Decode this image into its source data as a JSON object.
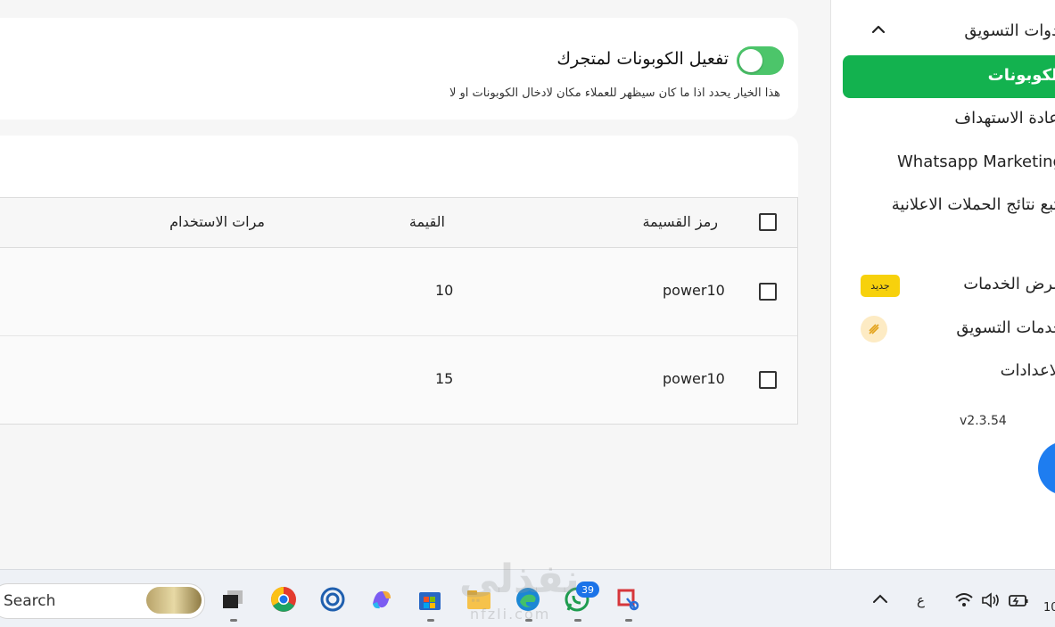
{
  "sidebar": {
    "parent_label": "أدوات التسويق",
    "active_label": "الكوبونات",
    "items": [
      {
        "label": "اعادة الاستهداف"
      },
      {
        "label": "Whatsapp Marketing"
      },
      {
        "label": "تتبع نتائج الحملات الاعلانية"
      },
      {
        "label": "عرض الخدمات"
      },
      {
        "label": "خدمات التسويق"
      },
      {
        "label": "الاعدادات"
      }
    ],
    "new_badge": "جديد",
    "version": "v2.3.54"
  },
  "coupon_settings": {
    "toggle_label": "تفعيل الكوبونات لمتجرك",
    "toggle_on": true,
    "description": "هذا الخيار يحدد اذا ما كان سيظهر للعملاء مكان لادخال الكوبونات او لا"
  },
  "table": {
    "headers": {
      "code": "رمز القسيمة",
      "value": "القيمة",
      "uses": "مرات الاستخدام"
    },
    "rows": [
      {
        "code": "power10",
        "value": "10"
      },
      {
        "code": "power10",
        "value": "15"
      }
    ]
  },
  "taskbar": {
    "search_placeholder": "Search",
    "whatsapp_badge": "39",
    "language": "ع",
    "time_partial": "10"
  },
  "watermark": {
    "text": "نفذلي",
    "sub": "nfzli.com"
  },
  "colors": {
    "accent_green": "#13b24f",
    "toggle_green": "#4cc56a",
    "badge_yellow": "#f7d10c",
    "fab_blue": "#1e7df0"
  }
}
